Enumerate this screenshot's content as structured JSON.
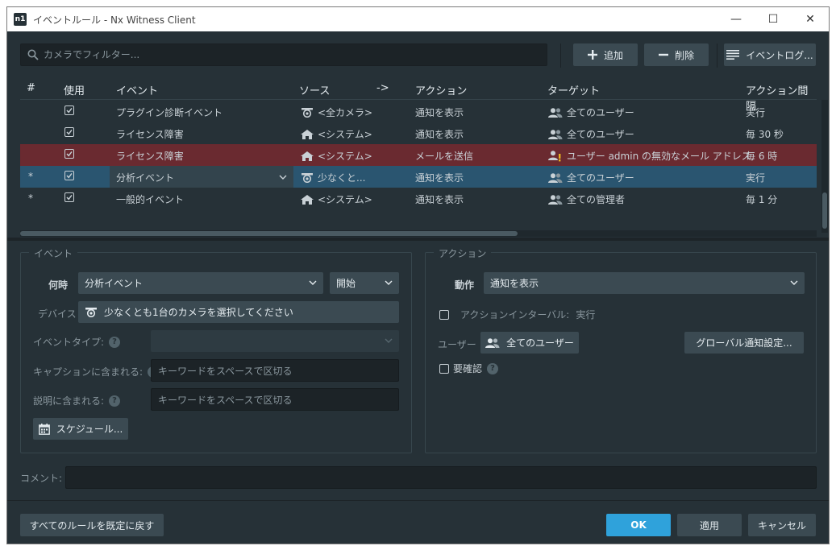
{
  "window": {
    "title": "イベントルール - Nx Witness Client",
    "logo_text": "n1",
    "minimize": "—",
    "maximize": "☐",
    "close": "✕"
  },
  "toolbar": {
    "search_placeholder": "カメラでフィルター...",
    "add_label": "追加",
    "delete_label": "削除",
    "eventlog_label": "イベントログ..."
  },
  "table": {
    "headers": {
      "num": "#",
      "enabled": "使用",
      "event": "イベント",
      "source": "ソース",
      "arrow": "->",
      "action": "アクション",
      "target": "ターゲット",
      "interval": "アクション間隔"
    },
    "rows": [
      {
        "num": "",
        "event": "プラグイン診断イベント",
        "source": "<全カメラ>",
        "action": "通知を表示",
        "target": "全てのユーザー",
        "interval": "実行"
      },
      {
        "num": "",
        "event": "ライセンス障害",
        "source": "<システム>",
        "action": "通知を表示",
        "target": "全てのユーザー",
        "interval": "毎 30 秒"
      },
      {
        "num": "",
        "event": "ライセンス障害",
        "source": "<システム>",
        "action": "メールを送信",
        "target": "ユーザー admin の無効なメール アドレス",
        "interval": "毎 6 時"
      },
      {
        "num": "*",
        "event": "分析イベント",
        "source": "少なくと...",
        "action": "通知を表示",
        "target": "全てのユーザー",
        "interval": "実行"
      },
      {
        "num": "*",
        "event": "一般的イベント",
        "source": "<システム>",
        "action": "通知を表示",
        "target": "全ての管理者",
        "interval": "毎 1 分"
      }
    ]
  },
  "event_panel": {
    "title": "イベント",
    "when_label": "何時",
    "when_value": "分析イベント",
    "state_value": "開始",
    "device_label": "デバイス",
    "device_value": "少なくとも1台のカメラを選択してください",
    "event_type_label": "イベントタイプ:",
    "caption_label": "キャプションに含まれる:",
    "caption_placeholder": "キーワードをスペースで区切る",
    "desc_label": "説明に含まれる:",
    "desc_placeholder": "キーワードをスペースで区切る",
    "schedule_label": "スケジュール..."
  },
  "action_panel": {
    "title": "アクション",
    "action_label": "動作",
    "action_value": "通知を表示",
    "interval_label": "アクションインターバル:",
    "interval_value": "実行",
    "users_label": "ユーザー",
    "users_value": "全てのユーザー",
    "global_btn": "グローバル通知設定...",
    "confirm_label": "要確認"
  },
  "comment": {
    "label": "コメント:"
  },
  "footer": {
    "reset_label": "すべてのルールを既定に戻す",
    "ok_label": "OK",
    "apply_label": "適用",
    "cancel_label": "キャンセル"
  },
  "help_glyph": "?",
  "colors": {
    "background": "#263137",
    "error_row": "#6a2a30",
    "selected_row": "#2a5570",
    "primary": "#2fa2db",
    "warning": "#e8b320"
  },
  "icons": [
    "search-icon",
    "plus-icon",
    "minus-icon",
    "list-icon",
    "camera-icon",
    "system-icon",
    "users-icon",
    "user-warning-icon",
    "chevron-down-icon",
    "calendar-icon",
    "checkbox-icon"
  ]
}
